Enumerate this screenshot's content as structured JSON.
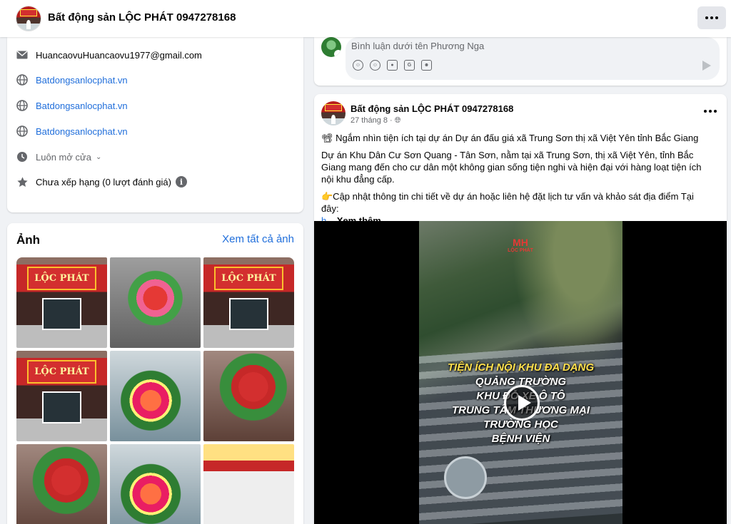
{
  "header": {
    "page_name": "Bất động sản LỘC PHÁT 0947278168",
    "more_label": "···"
  },
  "intro": {
    "email": "HuancaovuHuancaovu1977@gmail.com",
    "websites": [
      "Batdongsanlocphat.vn",
      "Batdongsanlocphat.vn",
      "Batdongsanlocphat.vn"
    ],
    "hours": "Luôn mở cửa",
    "rating": "Chưa xếp hạng (0 lượt đánh giá)",
    "rating_info": "i"
  },
  "photos": {
    "title": "Ảnh",
    "see_all": "Xem tất cả ảnh",
    "sign_text": "LỘC PHÁT"
  },
  "comment": {
    "placeholder": "Bình luận dưới tên Phương Nga",
    "tools": [
      "avatar-sticker-icon",
      "emoji-icon",
      "camera-icon",
      "gif-icon",
      "sticker-icon"
    ]
  },
  "post": {
    "author": "Bất động sản LỘC PHÁT 0947278168",
    "date": "27 tháng 8 ·",
    "line1": "📽 Ngắm nhìn tiện ích tại dự án Dự án đấu giá xã Trung Sơn thị xã Việt Yên tỉnh Bắc Giang",
    "line2": "Dự án Khu Dân Cư Sơn Quang - Tân Sơn, nằm tại xã Trung Sơn, thị xã Việt Yên, tỉnh Bắc Giang mang đến cho cư dân một không gian sống tiện nghi và hiện đại với hàng loạt tiện ích nội khu đẳng cấp.",
    "line3": "👉Cập nhật thông tin chi tiết về dự án hoặc liên hệ đặt lịch tư vấn và khảo sát địa điểm Tại đây:",
    "link_fragment": "h...",
    "see_more": "Xem thêm"
  },
  "video": {
    "logo": "MH",
    "logo_sub": "LỘC PHÁT",
    "headline": "TIỆN ÍCH NỘI KHU ĐA DẠNG",
    "items": [
      "QUẢNG TRƯỜNG",
      "KHU ĐỖ XE Ô TÔ",
      "TRUNG TÂM THƯƠNG MẠI",
      "TRƯỜNG HỌC",
      "BỆNH VIỆN"
    ]
  }
}
